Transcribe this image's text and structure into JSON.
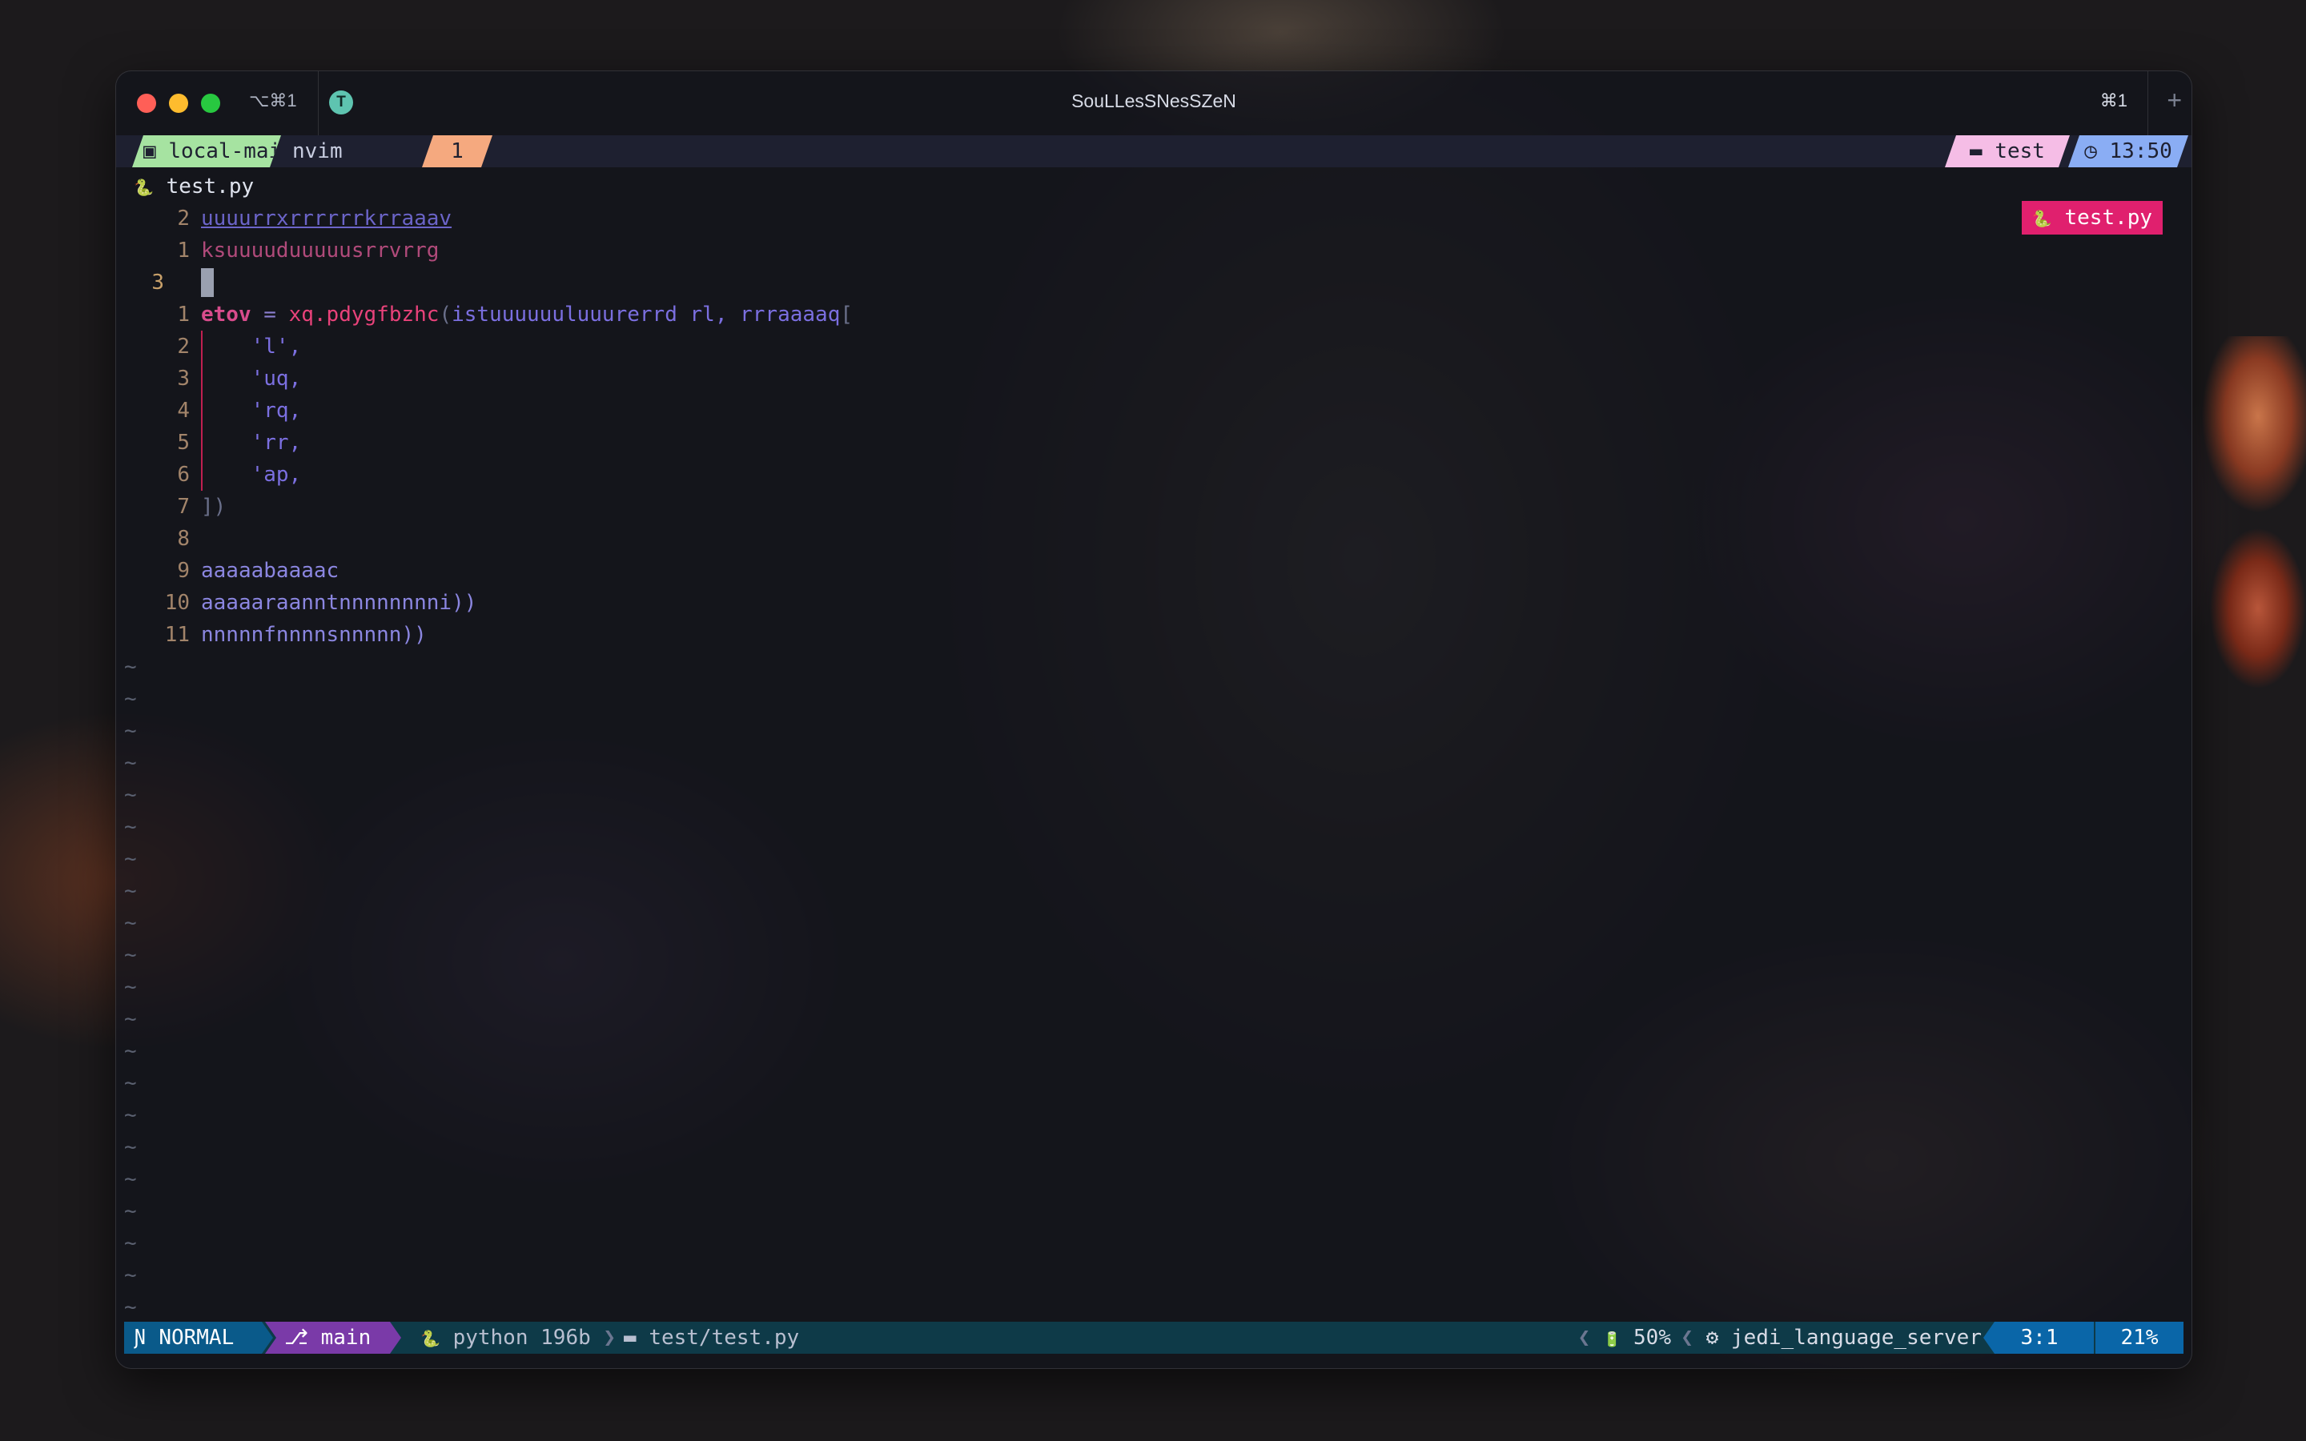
{
  "window": {
    "shortcut_left": "⌥⌘1",
    "app_icon_letter": "T",
    "title": "SouLLesSNesSZeN",
    "shortcut_right": "⌘1",
    "new_tab": "+"
  },
  "tmux": {
    "session_icon": "▣",
    "session": "local-main",
    "window_name": "nvim",
    "window_index": "1",
    "dir_icon": "▬",
    "dir": "test",
    "clock_icon": "◷",
    "time": "13:50"
  },
  "winbar": {
    "file_icon": "🐍",
    "filename": "test.py"
  },
  "float_tag": {
    "file_icon": "🐍",
    "filename": "test.py"
  },
  "editor": {
    "lines": [
      {
        "num": "2",
        "segments": [
          {
            "text": "uuuurrxrrrrrrkrraaav",
            "cls": "deleted"
          }
        ]
      },
      {
        "num": "1",
        "segments": [
          {
            "text": "ksuuuuduuuuusrrvrrg",
            "cls": "added"
          }
        ]
      },
      {
        "num": "3",
        "current": true,
        "segments": []
      },
      {
        "num": "1",
        "segments": [
          {
            "text": "etov",
            "cls": "c-ident"
          },
          {
            "text": " = ",
            "cls": "c-op"
          },
          {
            "text": "xq.pdygfbzhc",
            "cls": "c-fn"
          },
          {
            "text": "(",
            "cls": "c-dim"
          },
          {
            "text": "istuuuuuuluuurerrd rl, rrraaaaq",
            "cls": "c-args"
          },
          {
            "text": "[",
            "cls": "c-dim"
          }
        ]
      },
      {
        "num": "2",
        "segments": [
          {
            "text": "    'l',",
            "cls": "c-str"
          }
        ]
      },
      {
        "num": "3",
        "segments": [
          {
            "text": "    'uq,",
            "cls": "c-str"
          }
        ]
      },
      {
        "num": "4",
        "segments": [
          {
            "text": "    'rq,",
            "cls": "c-str"
          }
        ]
      },
      {
        "num": "5",
        "segments": [
          {
            "text": "    'rr,",
            "cls": "c-str"
          }
        ]
      },
      {
        "num": "6",
        "segments": [
          {
            "text": "    'ap,",
            "cls": "c-str"
          }
        ]
      },
      {
        "num": "7",
        "segments": [
          {
            "text": "])",
            "cls": "c-dim"
          }
        ]
      },
      {
        "num": "8",
        "segments": []
      },
      {
        "num": "9",
        "segments": [
          {
            "text": "aaaaabaaaac",
            "cls": "c-plain"
          }
        ]
      },
      {
        "num": "10",
        "segments": [
          {
            "text": "aaaaaraanntnnnnnnnni))",
            "cls": "c-plain"
          }
        ]
      },
      {
        "num": "11",
        "segments": [
          {
            "text": "nnnnnfnnnnsnnnnn))",
            "cls": "c-plain"
          }
        ]
      }
    ],
    "tilde": "~",
    "tilde_count": 21
  },
  "statusline": {
    "mode_icon": "Ɲ",
    "mode": "NORMAL",
    "branch_icon": "⎇",
    "branch": "main",
    "filetype_icon": "🐍",
    "filetype": "python 196b",
    "sep": "❯",
    "path_icon": "▬",
    "path": "test/test.py",
    "battery_icon": "🔋",
    "battery": "50%",
    "sep_left": "❮",
    "lsp_icon": "⚙",
    "lsp": "jedi_language_server",
    "position": "3:1",
    "percent": "21%"
  },
  "colors": {
    "session_green": "#a6e3a1",
    "window_orange": "#f5a97f",
    "dir_pink": "#f5bde6",
    "clock_blue": "#8aadf4",
    "mode_blue": "#0a5a8a",
    "branch_purple": "#7a3aa8",
    "tag_magenta": "#e0206e"
  }
}
